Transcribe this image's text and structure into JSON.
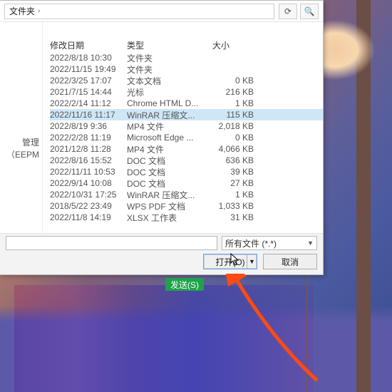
{
  "breadcrumb": {
    "label": "文件夹",
    "sep": "›"
  },
  "headers": {
    "date": "修改日期",
    "type": "类型",
    "size": "大小"
  },
  "sidebar": {
    "label": "管理（EEPM"
  },
  "filter": {
    "label": "所有文件 (*.*)"
  },
  "buttons": {
    "open": "打开(O)",
    "cancel": "取消"
  },
  "green": {
    "label": "发送(S)"
  },
  "rows": [
    {
      "date": "2022/8/18 10:30",
      "type": "文件夹",
      "size": ""
    },
    {
      "date": "2022/11/15 19:49",
      "type": "文件夹",
      "size": ""
    },
    {
      "date": "2022/3/25 17:07",
      "type": "文本文档",
      "size": "0 KB"
    },
    {
      "date": "2021/7/15 14:44",
      "type": "光标",
      "size": "216 KB"
    },
    {
      "date": "2022/2/14 11:12",
      "type": "Chrome HTML D...",
      "size": "1 KB"
    },
    {
      "date": "2022/11/16 11:17",
      "type": "WinRAR 压缩文...",
      "size": "115 KB",
      "sel": true
    },
    {
      "date": "2022/8/19 9:36",
      "type": "MP4 文件",
      "size": "2,018 KB"
    },
    {
      "date": "2022/2/28 11:19",
      "type": "Microsoft Edge ...",
      "size": "0 KB"
    },
    {
      "date": "2021/12/8 11:28",
      "type": "MP4 文件",
      "size": "4,066 KB"
    },
    {
      "date": "2022/8/16 15:52",
      "type": "DOC 文档",
      "size": "636 KB"
    },
    {
      "date": "2022/11/11 10:53",
      "type": "DOC 文档",
      "size": "39 KB"
    },
    {
      "date": "2022/9/14 10:08",
      "type": "DOC 文档",
      "size": "27 KB"
    },
    {
      "date": "2022/10/31 17:25",
      "type": "WinRAR 压缩文...",
      "size": "1 KB"
    },
    {
      "date": "2018/5/22 23:49",
      "type": "WPS PDF 文档",
      "size": "1,033 KB"
    },
    {
      "date": "2022/11/8 14:19",
      "type": "XLSX 工作表",
      "size": "31 KB"
    }
  ]
}
